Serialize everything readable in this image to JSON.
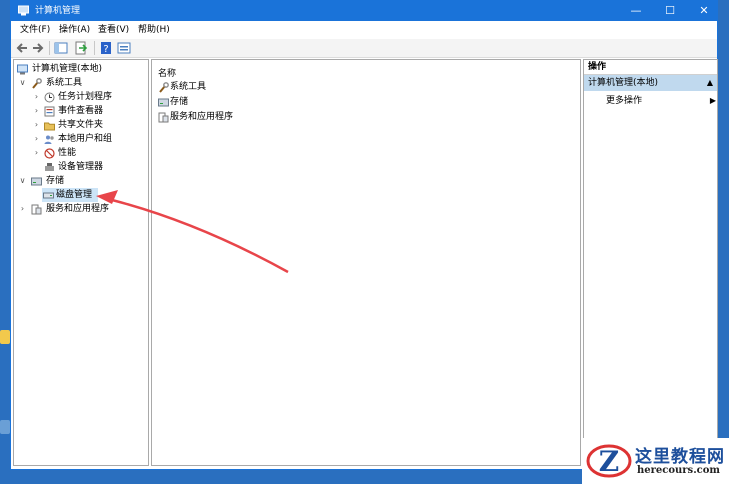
{
  "window": {
    "title": "计算机管理",
    "controls": [
      "—",
      "☐",
      "✕"
    ]
  },
  "menu": [
    "文件(F)",
    "操作(A)",
    "查看(V)",
    "帮助(H)"
  ],
  "tree": [
    {
      "label": "计算机管理(本地)",
      "expander": "",
      "icon": "computer-management-icon"
    },
    {
      "label": "系统工具",
      "expander": "∨",
      "icon": "system-tools-icon"
    },
    {
      "label": "任务计划程序",
      "expander": "›",
      "icon": "task-scheduler-icon"
    },
    {
      "label": "事件查看器",
      "expander": "›",
      "icon": "event-viewer-icon"
    },
    {
      "label": "共享文件夹",
      "expander": "›",
      "icon": "shared-folders-icon"
    },
    {
      "label": "本地用户和组",
      "expander": "›",
      "icon": "users-groups-icon"
    },
    {
      "label": "性能",
      "expander": "›",
      "icon": "performance-icon"
    },
    {
      "label": "设备管理器",
      "expander": "",
      "icon": "device-manager-icon"
    },
    {
      "label": "存储",
      "expander": "∨",
      "icon": "storage-icon"
    },
    {
      "label": "磁盘管理",
      "expander": "",
      "icon": "disk-management-icon"
    },
    {
      "label": "服务和应用程序",
      "expander": "›",
      "icon": "services-apps-icon"
    }
  ],
  "list": {
    "column_header": "名称",
    "items": [
      "系统工具",
      "存储",
      "服务和应用程序"
    ]
  },
  "actions": {
    "title": "操作",
    "group": "计算机管理(本地)",
    "group_arrow": "▲",
    "more": "更多操作",
    "more_arrow": "▶"
  },
  "watermark": {
    "line1": "这里教程网",
    "line2": "herecours.com"
  },
  "colors": {
    "titlebar": "#1a73d9",
    "selection": "#cce4f7",
    "actions_group": "#c0d9ee",
    "annotation_arrow": "#e8454a"
  }
}
